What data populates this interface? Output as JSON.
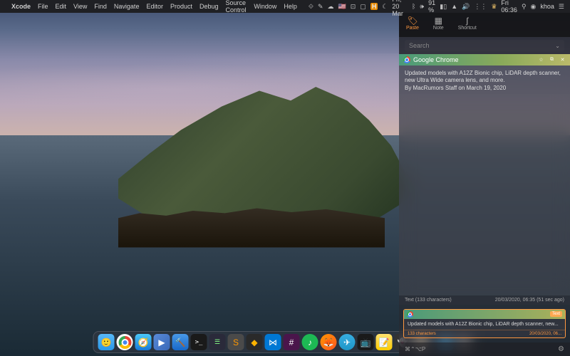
{
  "menubar": {
    "apple": "",
    "app": "Xcode",
    "items": [
      "File",
      "Edit",
      "View",
      "Find",
      "Navigate",
      "Editor",
      "Product",
      "Debug",
      "Source Control",
      "Window",
      "Help"
    ],
    "status": {
      "flag": "🇺🇸",
      "h_badge": "H",
      "date": "Fri, 20 Mar",
      "battery_pct": "91 %",
      "clock": "Fri 06:36",
      "user": "khoa"
    }
  },
  "panel": {
    "tabs": [
      {
        "icon": "🏷",
        "label": "Paste"
      },
      {
        "icon": "▦",
        "label": "Note"
      },
      {
        "icon": "ʃ",
        "label": "Shortcut"
      }
    ],
    "active_tab": 0,
    "search_placeholder": "Search",
    "card": {
      "app": "Google Chrome",
      "body_line1": "Updated models with A12Z Bionic chip, LiDAR depth scanner, new Ultra Wide camera lens, and more.",
      "body_line2": "By MacRumors Staff on March 19, 2020",
      "footer_left": "Text (133 characters)",
      "footer_right": "20/03/2020, 06:35 (51 sec ago)"
    },
    "history": {
      "badge": "Text",
      "body": "Updated models with A12Z Bionic chip, LiDAR depth scanner, new...",
      "chars": "133 characters",
      "time": "20/03/2020, 06..."
    },
    "footer": {
      "shortcut": "⌘⌃⌥P",
      "gear": "⚙"
    }
  },
  "dock": {
    "items": [
      "finder",
      "chrome",
      "safari",
      "generic1",
      "xcode",
      "iterm",
      "generic2",
      "sublime",
      "sketch",
      "vscode",
      "slack",
      "spotify",
      "firefox",
      "telegram",
      "appletv",
      "notes",
      "ghost",
      "brave"
    ]
  }
}
